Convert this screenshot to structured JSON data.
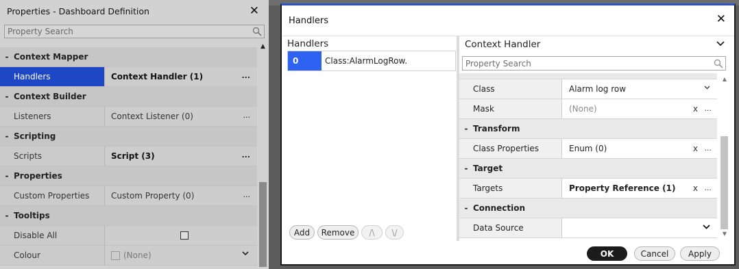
{
  "properties_panel": {
    "title": "Properties - Dashboard Definition",
    "search_placeholder": "Property Search",
    "categories": [
      {
        "label": "Context Mapper",
        "rows": [
          {
            "name": "Handlers",
            "value": "Context Handler (1)",
            "bold": true,
            "selected": true
          }
        ]
      },
      {
        "label": "Context Builder",
        "rows": [
          {
            "name": "Listeners",
            "value": "Context Listener (0)",
            "bold": false
          }
        ]
      },
      {
        "label": "Scripting",
        "rows": [
          {
            "name": "Scripts",
            "value": "Script (3)",
            "bold": true
          }
        ]
      },
      {
        "label": "Properties",
        "rows": [
          {
            "name": "Custom Properties",
            "value": "Custom Property (0)",
            "bold": false
          }
        ]
      },
      {
        "label": "Tooltips",
        "rows": [
          {
            "name": "Disable All"
          },
          {
            "name": "Colour",
            "value": "(None)"
          }
        ]
      }
    ]
  },
  "dialog": {
    "title": "Handlers",
    "handlers_label": "Handlers",
    "handler_items": [
      {
        "index": "0",
        "class": "Class:AlarmLogRow."
      }
    ],
    "buttons": {
      "add": "Add",
      "remove": "Remove",
      "up": "/\\",
      "down": "\\/"
    },
    "context_header": "Context Handler",
    "search_placeholder": "Property Search",
    "grid": {
      "class_label": "Class",
      "class_value": "Alarm log row",
      "mask_label": "Mask",
      "mask_value": "(None)",
      "transform_label": "Transform",
      "class_props_label": "Class Properties",
      "class_props_value": "Enum (0)",
      "target_label": "Target",
      "targets_label": "Targets",
      "targets_value": "Property Reference (1)",
      "connection_label": "Connection",
      "data_source_label": "Data Source",
      "data_source_value": ""
    },
    "ok": "OK",
    "cancel": "Cancel",
    "apply": "Apply"
  }
}
